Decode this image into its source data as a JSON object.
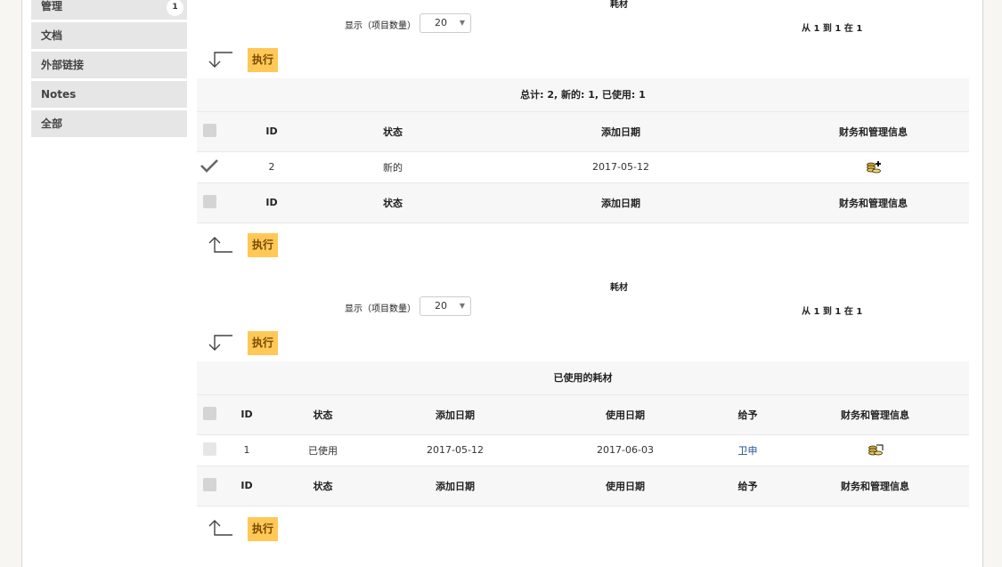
{
  "sidebar": {
    "items": [
      {
        "label": "管理",
        "badge": "1"
      },
      {
        "label": "文档"
      },
      {
        "label": "外部链接"
      },
      {
        "label": "Notes"
      },
      {
        "label": "全部"
      }
    ]
  },
  "section_new": {
    "caption": "耗材",
    "show_label": "显示（项目数量）",
    "page_size": "20",
    "pager": "从 1 到 1 在 1",
    "execute_label": "执行",
    "summary": "总计: 2, 新的: 1, 已使用: 1",
    "columns": [
      "ID",
      "状态",
      "添加日期",
      "财务和管理信息"
    ],
    "rows": [
      {
        "id": "2",
        "status": "新的",
        "added": "2017-05-12",
        "checked": true
      }
    ]
  },
  "section_used": {
    "caption": "耗材",
    "show_label": "显示（项目数量）",
    "page_size": "20",
    "pager": "从 1 到 1 在 1",
    "execute_label": "执行",
    "summary": "已使用的耗材",
    "columns": [
      "ID",
      "状态",
      "添加日期",
      "使用日期",
      "给予",
      "财务和管理信息"
    ],
    "rows": [
      {
        "id": "1",
        "status": "已使用",
        "added": "2017-05-12",
        "used": "2017-06-03",
        "given_to": "卫申"
      }
    ]
  },
  "colors": {
    "execute_button": "#ffc857",
    "link": "#1f4e96",
    "page_background": "#f7f6f2"
  }
}
